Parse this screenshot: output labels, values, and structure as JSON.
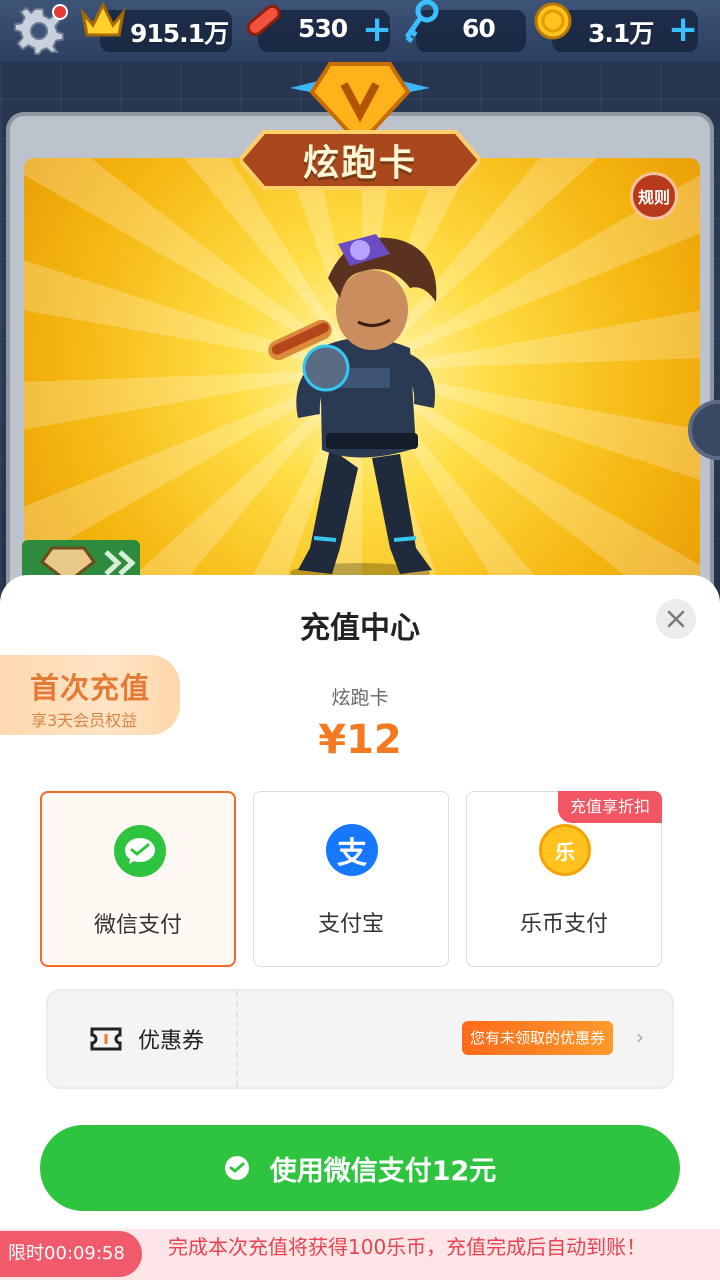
{
  "topbar": {
    "crowns": "915.1万",
    "boards": "530",
    "keys": "60",
    "coins": "3.1万"
  },
  "card": {
    "banner": "炫跑卡",
    "rules": "规则"
  },
  "sheet": {
    "title": "充值中心",
    "first_recharge": {
      "title": "首次充值",
      "subtitle": "享3天会员权益"
    },
    "product_name": "炫跑卡",
    "price": "¥12",
    "pay_options": [
      {
        "label": "微信支付",
        "selected": true
      },
      {
        "label": "支付宝",
        "selected": false
      },
      {
        "label": "乐币支付",
        "selected": false,
        "tag": "充值享折扣"
      }
    ],
    "coupon": {
      "label": "优惠券",
      "badge": "您有未领取的优惠券"
    },
    "pay_button": "使用微信支付12元",
    "timer": "限时00:09:58",
    "promo": "完成本次充值将获得100乐币，充值完成后自动到账！"
  },
  "colors": {
    "accent_orange": "#f47a1f",
    "wechat_green": "#2ec43f",
    "alipay_blue": "#1677ff",
    "promo_red": "#e8434e"
  },
  "icons": [
    "gear-icon",
    "crown-icon",
    "skateboard-icon",
    "key-icon",
    "coin-icon",
    "plus-icon",
    "close-icon",
    "wechat-icon",
    "alipay-icon",
    "lecoin-icon",
    "ticket-icon",
    "chevron-right-icon"
  ]
}
